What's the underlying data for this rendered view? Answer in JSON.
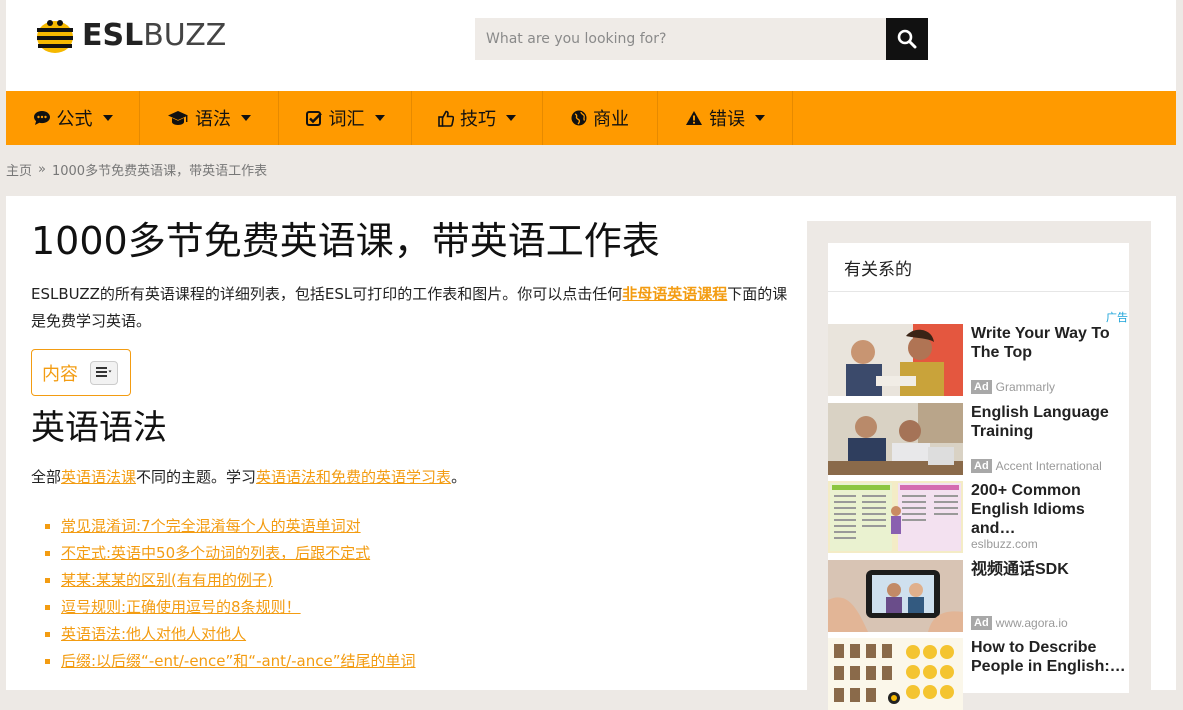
{
  "header": {
    "logo_bold": "ESL",
    "logo_light": "BUZZ",
    "search_placeholder": "What are you looking for?"
  },
  "nav": [
    {
      "label": "公式",
      "icon": "comments-icon",
      "has_caret": true
    },
    {
      "label": "语法",
      "icon": "graduation-cap-icon",
      "has_caret": true
    },
    {
      "label": "词汇",
      "icon": "check-square-icon",
      "has_caret": true
    },
    {
      "label": "技巧",
      "icon": "thumbs-up-icon",
      "has_caret": true
    },
    {
      "label": "商业",
      "icon": "globe-icon",
      "has_caret": false
    },
    {
      "label": "错误",
      "icon": "warning-icon",
      "has_caret": true
    }
  ],
  "breadcrumb": {
    "home": "主页",
    "separator": "»",
    "current": "1000多节免费英语课，带英语工作表"
  },
  "article": {
    "title": "1000多节免费英语课，带英语工作表",
    "intro_before": "ESLBUZZ的所有英语课程的详细列表，包括ESL可打印的工作表和图片。你可以点击任何",
    "intro_link": "非母语英语课程",
    "intro_after": "下面的课是免费学习英语。",
    "toc_label": "内容",
    "section_title": "英语语法",
    "desc_before": "全部",
    "desc_link1": "英语语法课",
    "desc_middle": "不同的主题。学习",
    "desc_link2": "英语语法和免费的英语学习表",
    "desc_after": "。",
    "links": [
      "常见混淆词:7个完全混淆每个人的英语单词对",
      "不定式:英语中50多个动词的列表，后跟不定式",
      "某某:某某的区别(有有用的例子)",
      "逗号规则:正确使用逗号的8条规则！",
      "英语语法:他人对他人对他人",
      "后缀:以后缀“-ent/-ence”和“-ant/-ance”结尾的单词"
    ]
  },
  "sidebar": {
    "title": "有关系的",
    "ad_flag": "广告",
    "ads": [
      {
        "title": "Write Your Way To The Top",
        "badge": "Ad",
        "source": "Grammarly"
      },
      {
        "title": "English Language Training",
        "badge": "Ad",
        "source": "Accent International"
      },
      {
        "title": "200+ Common English Idioms and…",
        "badge": "",
        "source": "eslbuzz.com"
      },
      {
        "title": "视频通话SDK",
        "badge": "Ad",
        "source": "www.agora.io"
      },
      {
        "title": "How to Describe People in English:…",
        "badge": "",
        "source": ""
      }
    ]
  },
  "colors": {
    "accent": "#ff9a00",
    "link": "#f39c12",
    "page_bg": "#ede9e5"
  }
}
